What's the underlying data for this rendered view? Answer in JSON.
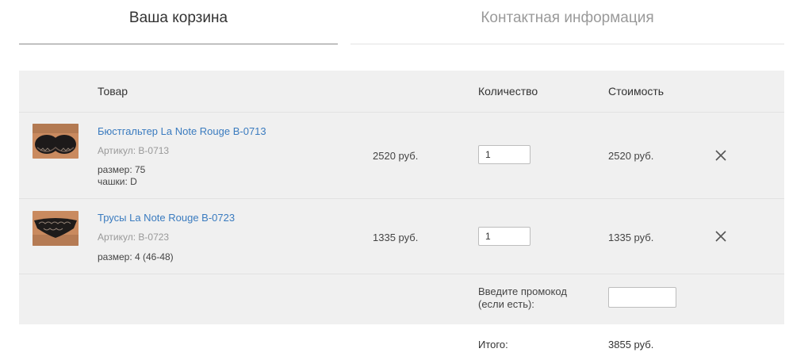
{
  "tabs": {
    "cart": "Ваша корзина",
    "contact": "Контактная информация"
  },
  "table": {
    "col_product": "Товар",
    "col_quantity": "Количество",
    "col_cost": "Стоимость"
  },
  "items": [
    {
      "name": "Бюстгальтер La Note Rouge B-0713",
      "sku": "Артикул: B-0713",
      "options": [
        "размер: 75",
        "чашки: D"
      ],
      "price": "2520 руб.",
      "quantity": "1",
      "total": "2520 руб.",
      "image_icon": "bra-thumbnail",
      "remove_icon": "close-icon"
    },
    {
      "name": "Трусы La Note Rouge B-0723",
      "sku": "Артикул: B-0723",
      "options": [
        "размер: 4 (46-48)"
      ],
      "price": "1335 руб.",
      "quantity": "1",
      "total": "1335 руб.",
      "image_icon": "panties-thumbnail",
      "remove_icon": "close-icon"
    }
  ],
  "promo": {
    "label_line1": "Введите промокод",
    "label_line2": "(если есть):",
    "value": ""
  },
  "summary": {
    "label": "Итого:",
    "value": "3855 руб."
  },
  "colors": {
    "link": "#3a7bbf",
    "table_bg": "#f0f0f0",
    "muted": "#999999"
  }
}
